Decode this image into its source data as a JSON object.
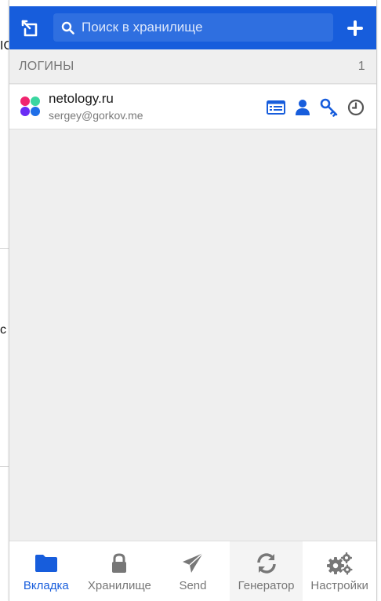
{
  "background": {
    "fragment_top": "IC",
    "fragment_mid": "c"
  },
  "header": {
    "popout_icon": "popout-icon",
    "search": {
      "placeholder": "Поиск в хранилище",
      "value": "",
      "icon": "search-icon"
    },
    "add_icon": "plus-icon"
  },
  "section": {
    "title": "ЛОГИНЫ",
    "count": "1"
  },
  "logins": [
    {
      "name": "netology.ru",
      "username": "sergey@gorkov.me",
      "actions": [
        "view-details-icon",
        "copy-username-icon",
        "copy-password-icon",
        "history-icon"
      ]
    }
  ],
  "tabs": [
    {
      "label": "Вкладка",
      "icon": "folder-icon",
      "active": true
    },
    {
      "label": "Хранилище",
      "icon": "lock-icon",
      "active": false
    },
    {
      "label": "Send",
      "icon": "paper-plane-icon",
      "active": false
    },
    {
      "label": "Генератор",
      "icon": "refresh-icon",
      "active": false
    },
    {
      "label": "Настройки",
      "icon": "cogs-icon",
      "active": false
    }
  ],
  "colors": {
    "brand": "#175ddc",
    "muted": "#777777",
    "favicon": [
      "#f0256f",
      "#3ad6a0",
      "#6a2cf5",
      "#1f6fe8"
    ]
  }
}
